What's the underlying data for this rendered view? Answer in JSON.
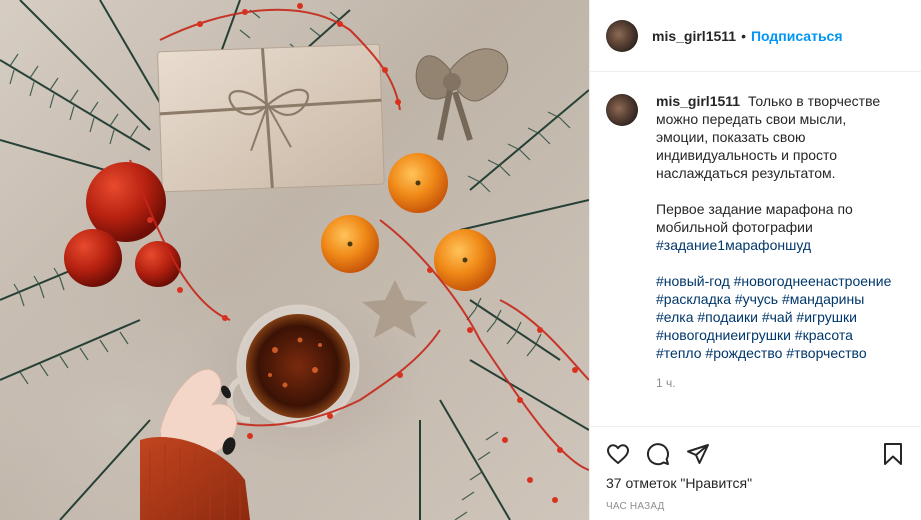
{
  "photo": {
    "icon": "post-image"
  },
  "header": {
    "username": "mis_girl1511",
    "separator": "•",
    "follow_label": "Подписаться"
  },
  "caption": {
    "username": "mis_girl1511",
    "paragraph_1": "Только в творчестве можно передать свои мысли, эмоции, показать свою индивидуальность и просто наслаждаться результатом.",
    "paragraph_2": "Первое задание марафона по мобильной фотографии",
    "hashtags_line_1": "#задание1марафоншуд",
    "hashtags_block": "#новый-год #новогоднеенастроение #раскладка #учусь #мандарины #елка #подаики #чай #игрушки #новогодниеигрушки #красота #тепло #рождество #творчество",
    "time": "1 ч."
  },
  "actions": {
    "like_icon": "heart-icon",
    "comment_icon": "comment-icon",
    "share_icon": "share-icon",
    "save_icon": "bookmark-icon",
    "likes_text": "37 отметок \"Нравится\"",
    "date_text": "ЧАС НАЗАД"
  },
  "colors": {
    "link_blue": "#0095f6",
    "hashtag": "#00376b",
    "muted": "#8e8e8e",
    "text": "#262626"
  }
}
